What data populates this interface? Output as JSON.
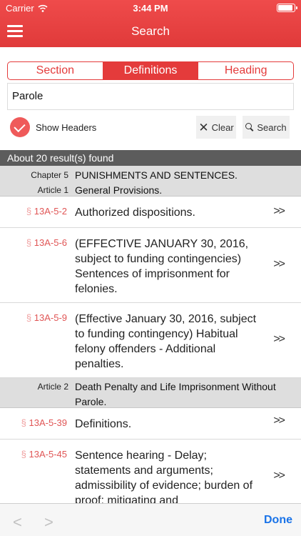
{
  "status": {
    "carrier": "Carrier",
    "time": "3:44 PM"
  },
  "nav": {
    "title": "Search"
  },
  "segments": [
    "Section",
    "Definitions",
    "Heading"
  ],
  "search": {
    "value": "Parole"
  },
  "options": {
    "show_headers_label": "Show Headers",
    "clear_label": "Clear",
    "search_label": "Search"
  },
  "results": {
    "count_text": "About 20 result(s) found"
  },
  "list": {
    "chapter5": {
      "chapter_label": "Chapter 5",
      "chapter_title": "PUNISHMENTS AND SENTENCES.",
      "article_label": "Article 1",
      "article_title": "General Provisions."
    },
    "article2": {
      "article_label": "Article 2",
      "article_title": "Death Penalty and Life Imprisonment Without Parole."
    },
    "rows": [
      {
        "section_symbol": "§",
        "section": "13A-5-2",
        "description": "Authorized dispositions.",
        "arrow": ">>"
      },
      {
        "section_symbol": "§",
        "section": "13A-5-6",
        "description": "(EFFECTIVE JANUARY 30, 2016, subject to funding contingencies) Sentences of imprisonment for felonies.",
        "arrow": ">>"
      },
      {
        "section_symbol": "§",
        "section": "13A-5-9",
        "description": "(Effective January 30, 2016, subject to funding contingency) Habitual felony offenders - Additional penalties.",
        "arrow": ">>"
      },
      {
        "section_symbol": "§",
        "section": "13A-5-39",
        "description": "Definitions.",
        "arrow": ">>"
      },
      {
        "section_symbol": "§",
        "section": "13A-5-45",
        "description": "Sentence hearing - Delay; statements and arguments; admissibility of evidence; burden of proof; mitigating and",
        "arrow": ">>"
      }
    ]
  },
  "toolbar": {
    "back": "<",
    "forward": ">",
    "done_label": "Done"
  },
  "colors": {
    "accent": "#e43b3b",
    "link": "#1a73e8",
    "results_bar": "#5c5c5c"
  }
}
